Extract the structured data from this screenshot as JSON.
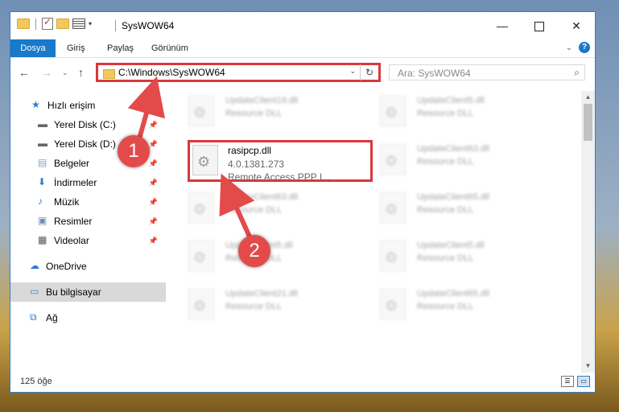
{
  "window": {
    "title": "SysWOW64",
    "controls": {
      "minimize": "—",
      "maximize": "",
      "close": "✕"
    }
  },
  "ribbon": {
    "tabs": [
      "Dosya",
      "Giriş",
      "Paylaş",
      "Görünüm"
    ],
    "help": "?"
  },
  "nav": {
    "address": "C:\\Windows\\SysWOW64",
    "search_placeholder": "Ara: SysWOW64"
  },
  "sidebar": {
    "items": [
      {
        "label": "Hızlı erişim",
        "icon": "star-icon",
        "pinned": false
      },
      {
        "label": "Yerel Disk (C:)",
        "icon": "drive-icon",
        "pinned": true
      },
      {
        "label": "Yerel Disk (D:)",
        "icon": "drive-icon",
        "pinned": true
      },
      {
        "label": "Belgeler",
        "icon": "documents-icon",
        "pinned": true
      },
      {
        "label": "İndirmeler",
        "icon": "download-icon",
        "pinned": true
      },
      {
        "label": "Müzik",
        "icon": "music-icon",
        "pinned": true
      },
      {
        "label": "Resimler",
        "icon": "pictures-icon",
        "pinned": true
      },
      {
        "label": "Videolar",
        "icon": "video-icon",
        "pinned": true
      },
      {
        "label": "OneDrive",
        "icon": "cloud-icon",
        "pinned": false
      },
      {
        "label": "Bu bilgisayar",
        "icon": "computer-icon",
        "pinned": false,
        "selected": true
      },
      {
        "label": "Ağ",
        "icon": "network-icon",
        "pinned": false
      }
    ]
  },
  "files": {
    "highlighted": {
      "name": "rasipcp.dll",
      "version": "4.0.1381.273",
      "description": "Remote Access PPP I..."
    },
    "left_column": [
      {
        "name": "UpdateClient19.dll",
        "description": "Resource DLL"
      },
      {
        "name": "UpdateClient63.dll",
        "description": "Resource DLL"
      },
      {
        "name": "UpdateClient5.dll",
        "description": "Resource DLL"
      },
      {
        "name": "UpdateClient21.dll",
        "description": "Resource DLL"
      }
    ],
    "right_column": [
      {
        "name": "UpdateClient5.dll",
        "description": "Resource DLL"
      },
      {
        "name": "UpdateClient63.dll",
        "description": "Resource DLL"
      },
      {
        "name": "UpdateClient65.dll",
        "description": "Resource DLL"
      },
      {
        "name": "UpdateClient5.dll",
        "description": "Resource DLL"
      },
      {
        "name": "UpdateClient65.dll",
        "description": "Resource DLL"
      }
    ]
  },
  "status": {
    "item_count": "125 öğe"
  },
  "annotations": {
    "badge1": "1",
    "badge2": "2",
    "color": "#e34b4b"
  }
}
